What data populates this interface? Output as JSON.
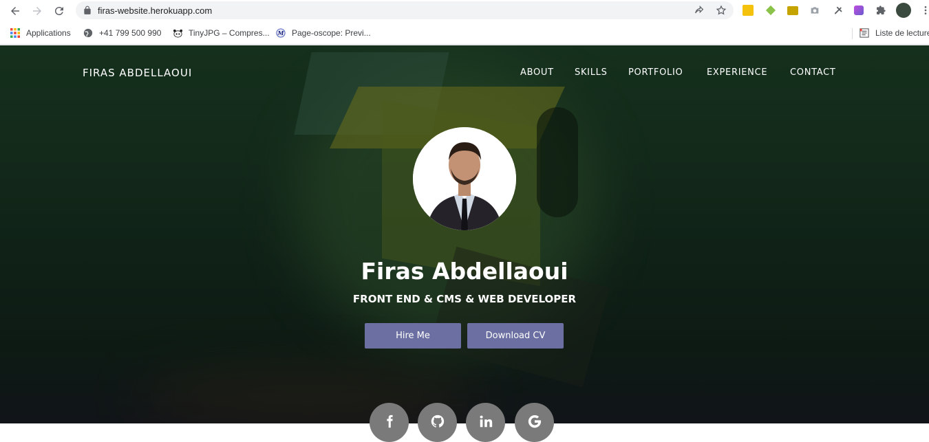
{
  "browser": {
    "url": "firas-website.herokuapp.com",
    "bookmarks": [
      {
        "label": "Applications",
        "icon": "apps-grid-icon"
      },
      {
        "label": "+41 799 500 990",
        "icon": "globe-icon"
      },
      {
        "label": "TinyJPG – Compres...",
        "icon": "panda-icon"
      },
      {
        "label": "Page-oscope: Previ...",
        "icon": "page-oscope-icon"
      }
    ],
    "reading_list": "Liste de lecture"
  },
  "site": {
    "brand": "FIRAS ABDELLAOUI",
    "nav": [
      "ABOUT",
      "SKILLS",
      "PORTFOLIO",
      "EXPERIENCE",
      "CONTACT"
    ],
    "name": "Firas Abdellaoui",
    "role": "FRONT END & CMS & WEB DEVELOPER",
    "buttons": {
      "hire": "Hire Me",
      "cv": "Download CV"
    },
    "social": [
      "facebook-icon",
      "github-icon",
      "linkedin-icon",
      "google-icon"
    ]
  },
  "colors": {
    "button": "#6b6fa1",
    "hero_dark": "#0f2016",
    "social_circle": "#7a7a7a"
  }
}
